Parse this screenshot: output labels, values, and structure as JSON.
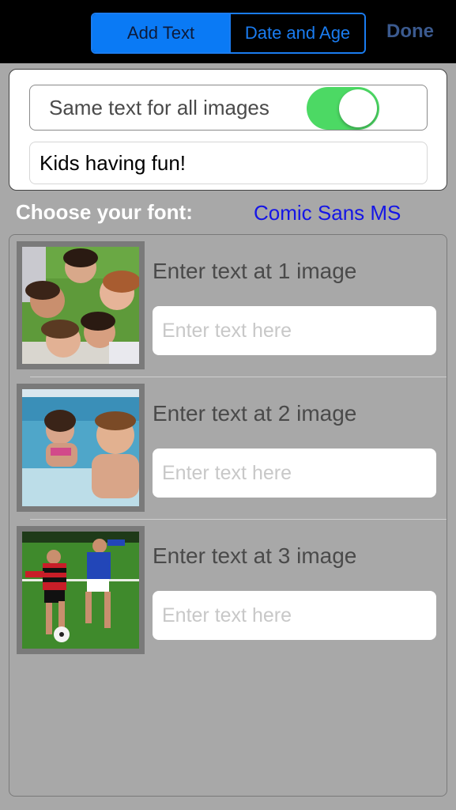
{
  "nav": {
    "tabs": [
      {
        "label": "Add Text",
        "active": true
      },
      {
        "label": "Date and Age",
        "active": false
      }
    ],
    "done_label": "Done"
  },
  "settings": {
    "same_text_label": "Same text for all images",
    "same_text_enabled": true,
    "shared_text_value": "Kids having fun!"
  },
  "font": {
    "label": "Choose your font:",
    "value": "Comic Sans MS"
  },
  "images": [
    {
      "caption": "Enter text at 1 image",
      "placeholder": "Enter text here",
      "value": ""
    },
    {
      "caption": "Enter text at 2 image",
      "placeholder": "Enter text here",
      "value": ""
    },
    {
      "caption": "Enter text at 3 image",
      "placeholder": "Enter text here",
      "value": ""
    }
  ],
  "colors": {
    "accent": "#0a7af5",
    "toggle_on": "#4cd964",
    "font_link": "#1515e6"
  }
}
